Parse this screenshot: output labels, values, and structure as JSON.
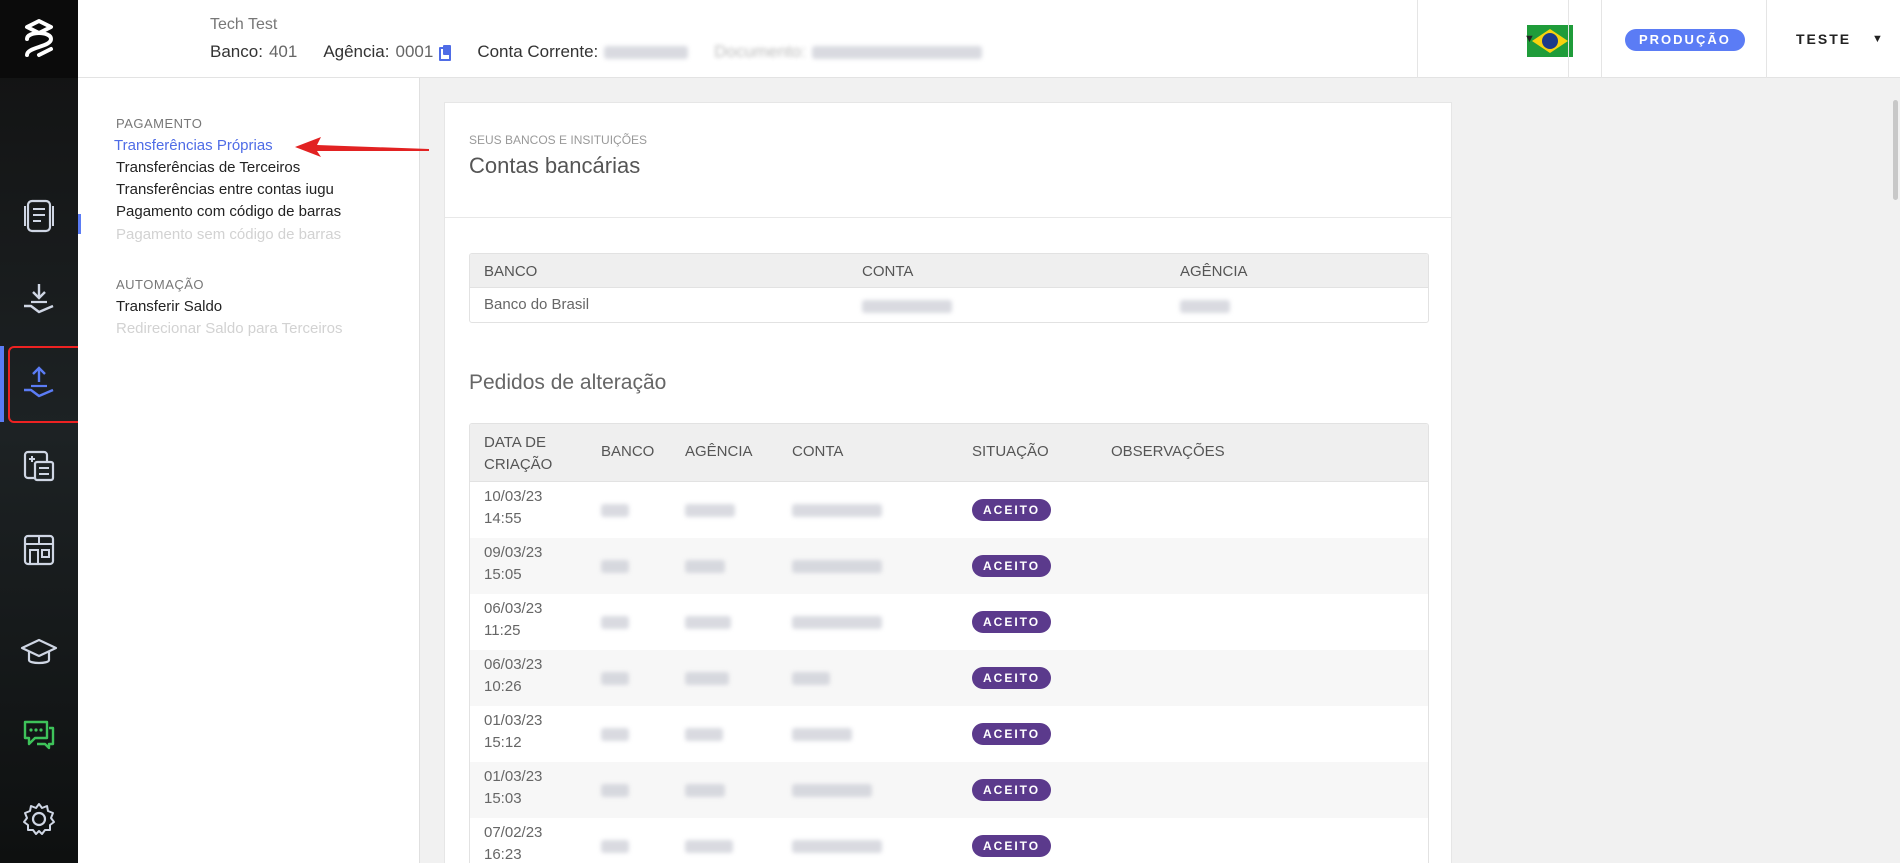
{
  "header": {
    "account_name": "Tech Test",
    "bank_label": "Banco:",
    "bank_value": "401",
    "agency_label": "Agência:",
    "agency_value": "0001",
    "account_label": "Conta Corrente:",
    "document_label": "Documento:",
    "environment_badge": "PRODUÇÃO",
    "user_name": "TESTE"
  },
  "subnav": {
    "sections": [
      {
        "title": "PAGAMENTO",
        "items": [
          {
            "label": "Transferências Próprias",
            "state": "active"
          },
          {
            "label": "Transferências de Terceiros",
            "state": "normal"
          },
          {
            "label": "Transferências entre contas iugu",
            "state": "normal"
          },
          {
            "label": "Pagamento com código de barras",
            "state": "normal"
          },
          {
            "label": "Pagamento sem código de barras",
            "state": "disabled"
          }
        ]
      },
      {
        "title": "AUTOMAÇÃO",
        "items": [
          {
            "label": "Transferir Saldo",
            "state": "normal"
          },
          {
            "label": "Redirecionar Saldo para Terceiros",
            "state": "disabled"
          }
        ]
      }
    ]
  },
  "rail": {
    "icons": [
      "invoice-icon",
      "receive-money-icon",
      "send-money-icon",
      "calculator-icon",
      "store-icon",
      "graduation-cap-icon",
      "chat-icon",
      "gear-icon"
    ],
    "active_icon": "send-money-icon"
  },
  "main": {
    "eyebrow": "SEUS BANCOS E INSITUIÇÕES",
    "title": "Contas bancárias",
    "bank_accounts": {
      "columns": [
        "BANCO",
        "CONTA",
        "AGÊNCIA"
      ],
      "rows": [
        {
          "banco": "Banco do Brasil"
        }
      ]
    },
    "change_requests_title": "Pedidos de alteração",
    "change_requests": {
      "columns": [
        "DATA DE CRIAÇÃO",
        "BANCO",
        "AGÊNCIA",
        "CONTA",
        "SITUAÇÃO",
        "OBSERVAÇÕES"
      ],
      "rows": [
        {
          "date": "10/03/23",
          "time": "14:55",
          "status": "ACEITO"
        },
        {
          "date": "09/03/23",
          "time": "15:05",
          "status": "ACEITO"
        },
        {
          "date": "06/03/23",
          "time": "11:25",
          "status": "ACEITO"
        },
        {
          "date": "06/03/23",
          "time": "10:26",
          "status": "ACEITO"
        },
        {
          "date": "01/03/23",
          "time": "15:12",
          "status": "ACEITO"
        },
        {
          "date": "01/03/23",
          "time": "15:03",
          "status": "ACEITO"
        },
        {
          "date": "07/02/23",
          "time": "16:23",
          "status": "ACEITO"
        }
      ]
    }
  },
  "colors": {
    "accent": "#5b7cf5",
    "status_badge": "#5b3a8c",
    "annotation": "#e22222"
  }
}
